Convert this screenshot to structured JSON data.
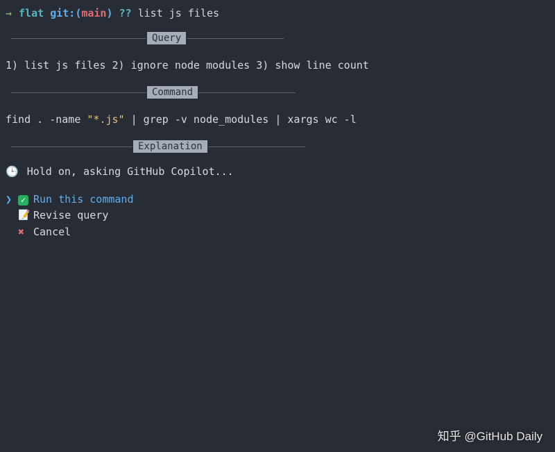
{
  "prompt": {
    "arrow": "→",
    "folder": "flat",
    "git_label": "git:",
    "paren_open": "(",
    "branch": "main",
    "paren_close": ")",
    "qq": "??",
    "input": "list js files"
  },
  "sections": {
    "query": {
      "label": "Query",
      "content": "1) list js files 2) ignore node modules 3) show line count"
    },
    "command": {
      "label": "Command",
      "prefix": "find . -name ",
      "string": "\"*.js\"",
      "suffix": " | grep -v node_modules | xargs wc -l"
    },
    "explanation": {
      "label": "Explanation",
      "status_icon": "🕒",
      "status_text": "Hold on, asking GitHub Copilot..."
    }
  },
  "menu": {
    "caret": "❯",
    "items": [
      {
        "icon": "✓",
        "icon_name": "check-icon",
        "label": "Run this command",
        "selected": true
      },
      {
        "icon": "📝",
        "icon_name": "pencil-icon",
        "label": "Revise query",
        "selected": false
      },
      {
        "icon": "✖",
        "icon_name": "cross-icon",
        "label": "Cancel",
        "selected": false
      }
    ]
  },
  "watermark": "知乎 @GitHub Daily"
}
